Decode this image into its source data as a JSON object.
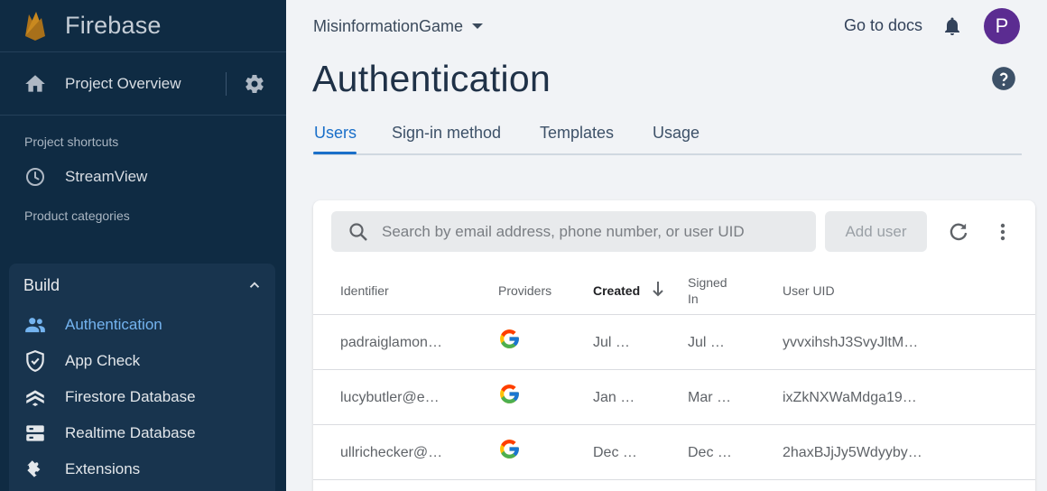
{
  "sidebar": {
    "brand": "Firebase",
    "overview_label": "Project Overview",
    "shortcuts_header": "Project shortcuts",
    "shortcut_label": "StreamView",
    "categories_header": "Product categories",
    "build_label": "Build",
    "items": [
      {
        "label": "Authentication",
        "icon": "people-icon",
        "active": true
      },
      {
        "label": "App Check",
        "icon": "shield-check-icon"
      },
      {
        "label": "Firestore Database",
        "icon": "firestore-icon"
      },
      {
        "label": "Realtime Database",
        "icon": "database-icon"
      },
      {
        "label": "Extensions",
        "icon": "puzzle-icon"
      }
    ]
  },
  "header": {
    "project_name": "MisinformationGame",
    "docs_link": "Go to docs",
    "avatar_letter": "P",
    "page_title": "Authentication"
  },
  "tabs": [
    "Users",
    "Sign-in method",
    "Templates",
    "Usage"
  ],
  "toolbar": {
    "search_placeholder": "Search by email address, phone number, or user UID",
    "add_user_label": "Add user"
  },
  "table": {
    "headers": [
      "Identifier",
      "Providers",
      "Created",
      "Signed In",
      "User UID"
    ],
    "signed_in_line1": "Signed",
    "signed_in_line2": "In",
    "rows": [
      {
        "identifier": "padraiglamon…",
        "provider": "google",
        "created": "Jul …",
        "signed_in": "Jul …",
        "uid": "yvvxihshJ3SvyJltM…"
      },
      {
        "identifier": "lucybutler@e…",
        "provider": "google",
        "created": "Jan …",
        "signed_in": "Mar …",
        "uid": "ixZkNXWaMdga19…"
      },
      {
        "identifier": "ullrichecker@…",
        "provider": "google",
        "created": "Dec …",
        "signed_in": "Dec …",
        "uid": "2haxBJjJy5Wdyyby…"
      }
    ]
  },
  "colors": {
    "sidebar_bg": "#0f2b43",
    "accent": "#1a6fc9",
    "avatar": "#5b2c91"
  }
}
